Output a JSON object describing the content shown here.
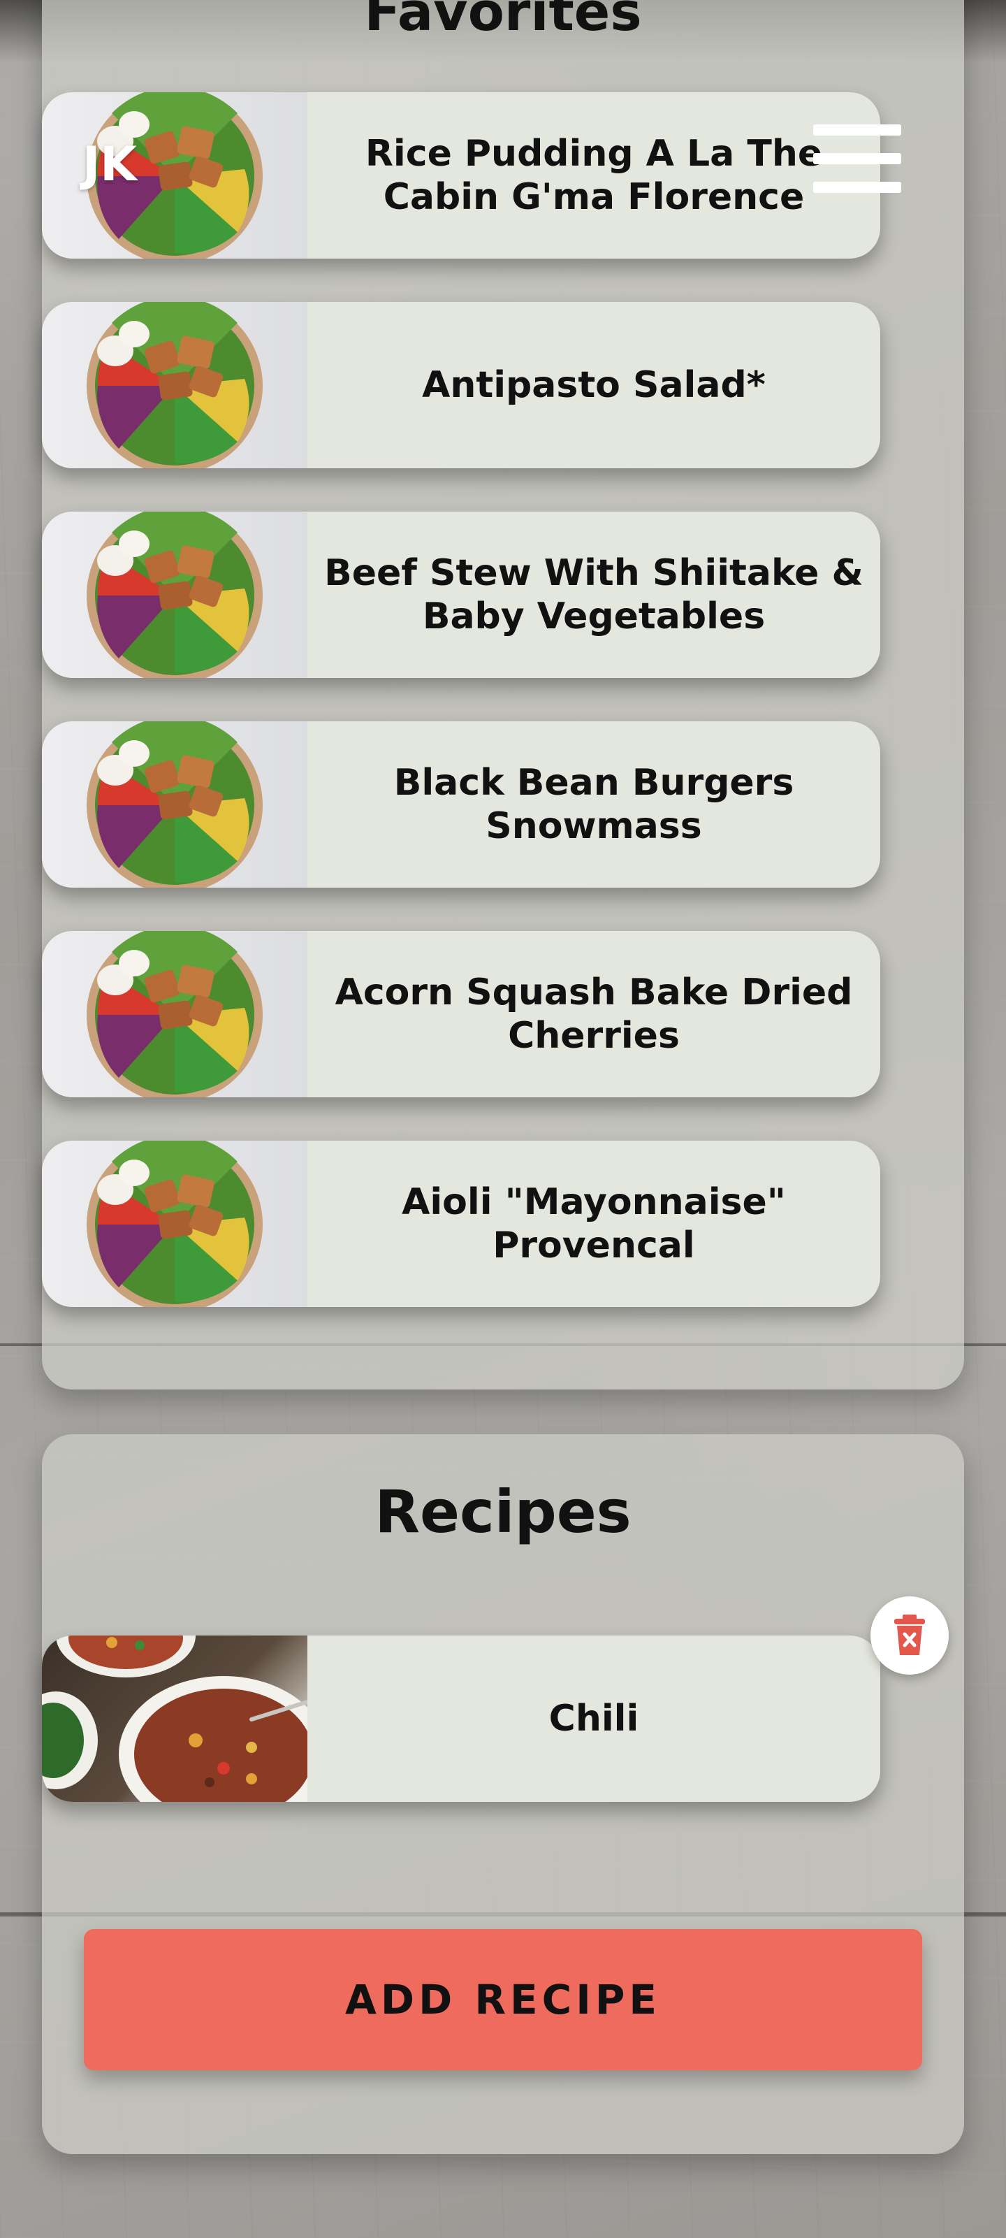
{
  "header": {
    "user_initials": "JK",
    "menu_icon": "hamburger-menu-icon"
  },
  "favorites": {
    "title": "Favorites",
    "items": [
      {
        "name": "Rice Pudding A La The Cabin G'ma Florence",
        "image": "salad-bowl"
      },
      {
        "name": "Antipasto Salad*",
        "image": "salad-bowl"
      },
      {
        "name": "Beef Stew With Shiitake & Baby Vegetables",
        "image": "salad-bowl"
      },
      {
        "name": "Black Bean Burgers Snowmass",
        "image": "salad-bowl"
      },
      {
        "name": "Acorn Squash Bake Dried Cherries",
        "image": "salad-bowl"
      },
      {
        "name": "Aioli \"Mayonnaise\" Provencal",
        "image": "salad-bowl"
      }
    ]
  },
  "recipes": {
    "title": "Recipes",
    "items": [
      {
        "name": "Chili",
        "image": "chili-bowl"
      }
    ],
    "delete_icon": "trash-icon",
    "add_button": "ADD RECIPE"
  },
  "colors": {
    "accent": "#ee6b5e",
    "card_bg": "#e4e7dd",
    "panel_bg": "#cdcdc6",
    "trash_red": "#e2584c"
  }
}
